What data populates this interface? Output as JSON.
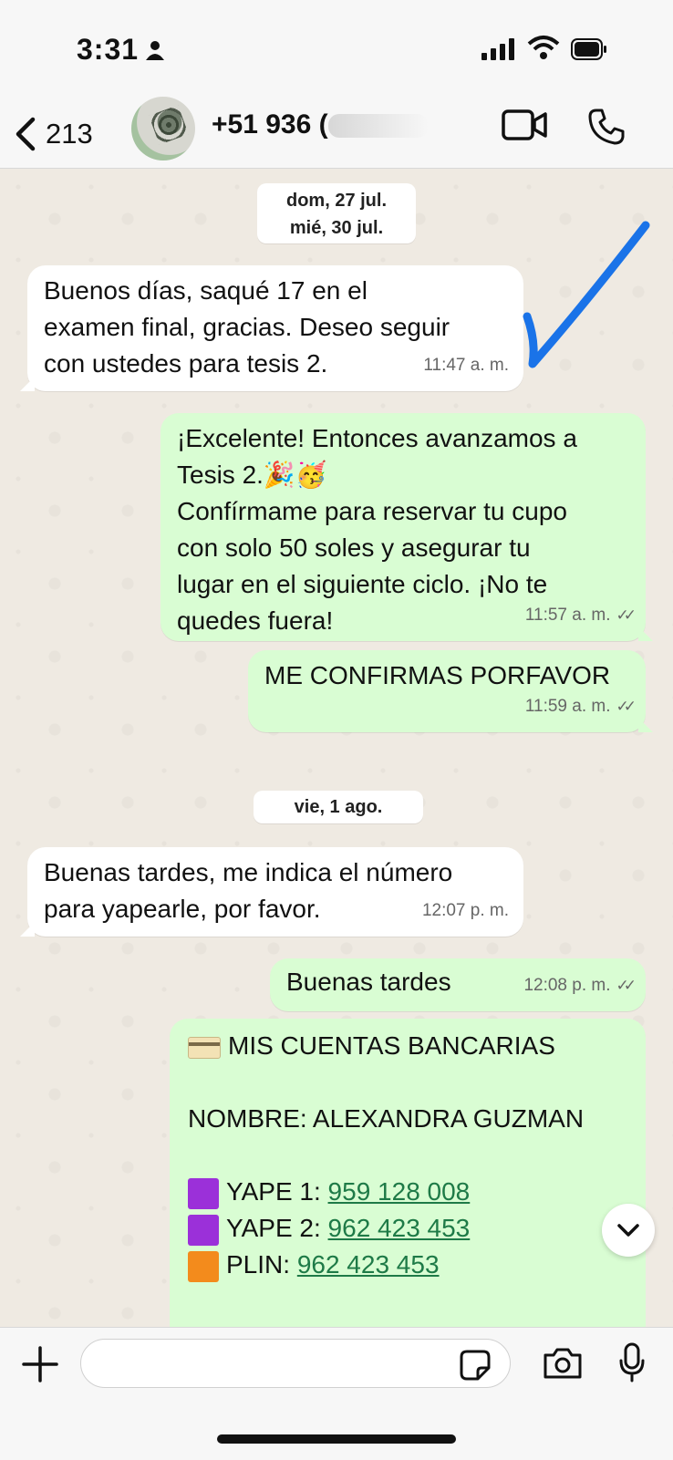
{
  "status_bar": {
    "time": "3:31"
  },
  "header": {
    "back_count": "213",
    "contact_title": "+51 936 ("
  },
  "dates": {
    "d1": "dom, 27 jul.",
    "d2": "mié, 30 jul.",
    "d3": "vie, 1 ago."
  },
  "messages": [
    {
      "direction": "in",
      "lines": [
        "Buenos días, saqué 17 en el",
        "examen final, gracias. Deseo seguir",
        "con ustedes para tesis 2."
      ],
      "time": "11:47 a. m."
    },
    {
      "direction": "out",
      "lines": [
        "¡Excelente! Entonces avanzamos a",
        "Tesis 2.🎉🥳",
        "Confírmame para reservar tu cupo",
        "con solo 50 soles y asegurar tu",
        "lugar en el siguiente ciclo. ¡No te",
        "quedes fuera!"
      ],
      "time": "11:57 a. m."
    },
    {
      "direction": "out",
      "lines": [
        "ME CONFIRMAS PORFAVOR"
      ],
      "time": "11:59 a. m."
    },
    {
      "direction": "in",
      "lines": [
        "Buenas tardes, me indica el número",
        "para yapearle, por favor."
      ],
      "time": "12:07 p. m."
    },
    {
      "direction": "out",
      "lines": [
        "Buenas tardes"
      ],
      "time": "12:08 p. m."
    }
  ],
  "bank_message": {
    "heading": "MIS CUENTAS BANCARIAS",
    "name_line": "NOMBRE: ALEXANDRA GUZMAN",
    "accounts": [
      {
        "label": "YAPE 1:",
        "number": "959 128 008",
        "color": "#9b30d9"
      },
      {
        "label": "YAPE 2:",
        "number": "962 423 453",
        "color": "#9b30d9"
      },
      {
        "label": "PLIN:",
        "number": "962 423 453",
        "color": "#f38b1c"
      }
    ]
  },
  "composer": {
    "placeholder": ""
  },
  "colors": {
    "incoming": "#ffffff",
    "outgoing": "#d9fdd3",
    "annotation_pen": "#1a73e8",
    "link": "#1e7a47"
  }
}
